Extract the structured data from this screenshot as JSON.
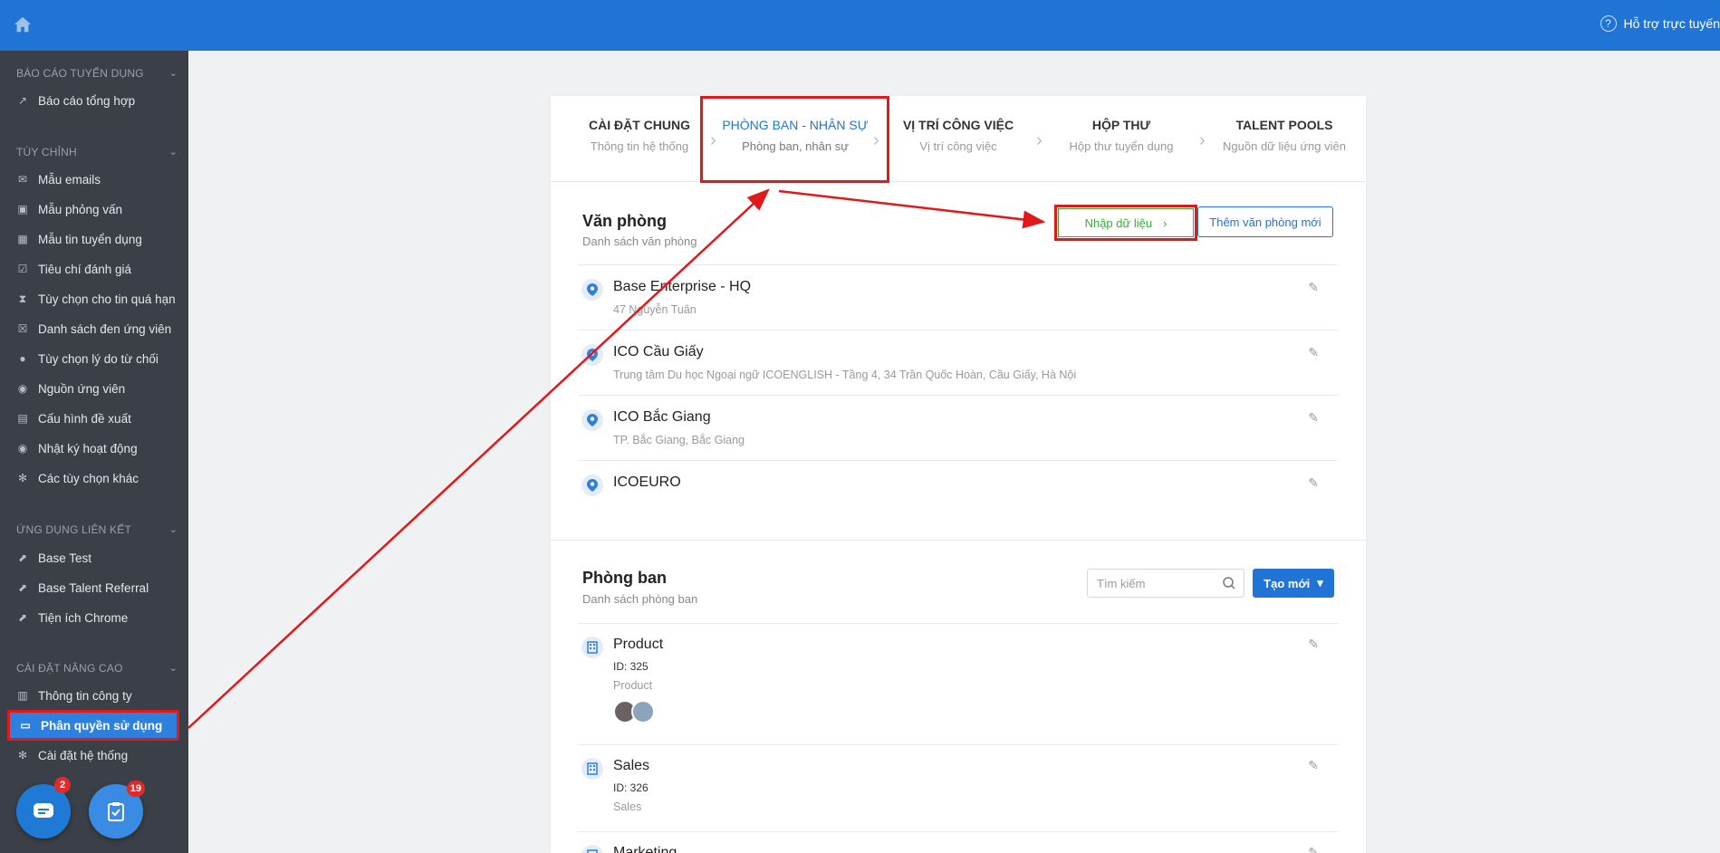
{
  "topbar": {
    "help_label": "Hỗ trợ trực tuyến"
  },
  "sidebar": {
    "sections": [
      {
        "title": "BÁO CÁO TUYỂN DỤNG",
        "items": [
          "Báo cáo tổng hợp"
        ]
      },
      {
        "title": "TÙY CHỈNH",
        "items": [
          "Mẫu emails",
          "Mẫu phỏng vấn",
          "Mẫu tin tuyển dụng",
          "Tiêu chí đánh giá",
          "Tùy chọn cho tin quá hạn",
          "Danh sách đen ứng viên",
          "Tùy chọn lý do từ chối",
          "Nguồn ứng viên",
          "Cấu hình đề xuất",
          "Nhật ký hoạt động",
          "Các tùy chọn khác"
        ]
      },
      {
        "title": "ỨNG DỤNG LIÊN KẾT",
        "items": [
          "Base Test",
          "Base Talent Referral",
          "Tiện ích Chrome"
        ]
      },
      {
        "title": "CÀI ĐẶT NÂNG CAO",
        "items": [
          "Thông tin công ty",
          "Phân quyền sử dụng",
          "Cài đặt hệ thống"
        ]
      }
    ],
    "chat_badge": "2",
    "tasks_badge": "19"
  },
  "steps": [
    {
      "title": "CÀI ĐẶT CHUNG",
      "sub": "Thông tin hệ thống"
    },
    {
      "title": "PHÒNG BAN - NHÂN SỰ",
      "sub": "Phòng ban, nhân sự"
    },
    {
      "title": "VỊ TRÍ CÔNG VIỆC",
      "sub": "Vị trí công việc"
    },
    {
      "title": "HỘP THƯ",
      "sub": "Hộp thư tuyển dụng"
    },
    {
      "title": "TALENT POOLS",
      "sub": "Nguồn dữ liệu ứng viên"
    }
  ],
  "offices": {
    "title": "Văn phòng",
    "subtitle": "Danh sách văn phòng",
    "import_label": "Nhập dữ liệu",
    "add_label": "Thêm văn phòng mới",
    "items": [
      {
        "name": "Base Enterprise - HQ",
        "address": "47 Nguyễn Tuân"
      },
      {
        "name": "ICO Cầu Giấy",
        "address": "Trung tâm Du học Ngoại ngữ ICOENGLISH - Tầng 4, 34 Trần Quốc Hoàn, Cầu Giấy, Hà Nội"
      },
      {
        "name": "ICO Bắc Giang",
        "address": "TP. Bắc Giang, Bắc Giang"
      },
      {
        "name": "ICOEURO",
        "address": ""
      }
    ]
  },
  "departments": {
    "title": "Phòng ban",
    "subtitle": "Danh sách phòng ban",
    "search_placeholder": "Tìm kiếm",
    "new_label": "Tạo mới",
    "items": [
      {
        "name": "Product",
        "id": "ID: 325",
        "desc": "Product"
      },
      {
        "name": "Sales",
        "id": "ID: 326",
        "desc": "Sales"
      },
      {
        "name": "Marketing",
        "id": "",
        "desc": ""
      }
    ]
  },
  "colors": {
    "topbar": "#1f74d6",
    "sidebar": "#3b4048",
    "highlight": "#e0191b",
    "import_green": "#3cab3c"
  }
}
